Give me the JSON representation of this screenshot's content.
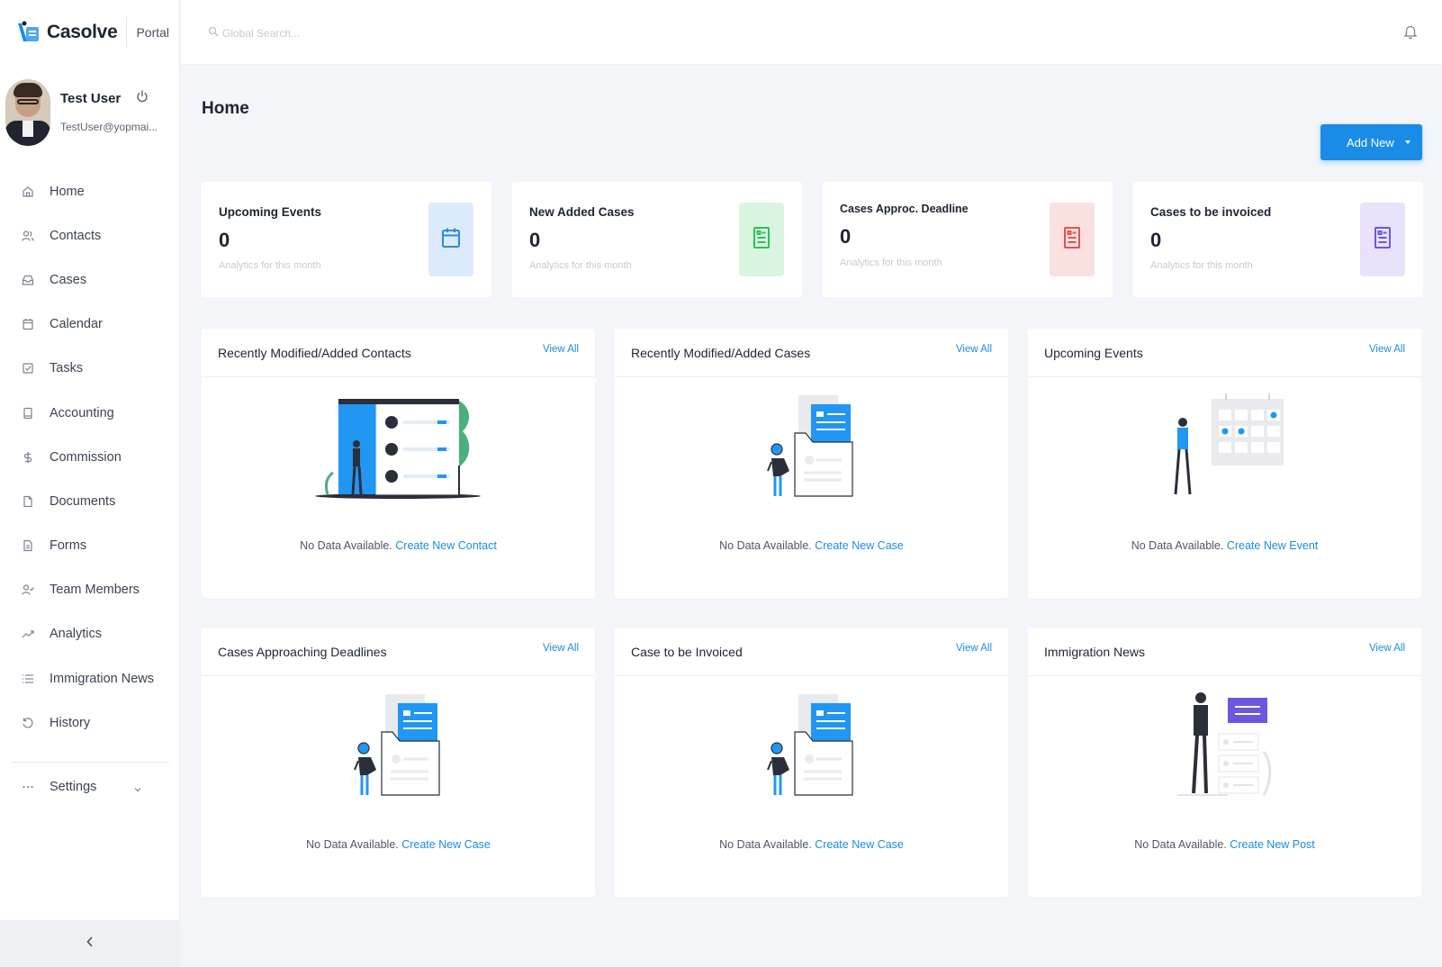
{
  "brand": {
    "name": "Casolve",
    "portal": "Portal"
  },
  "user": {
    "name": "Test User",
    "email": "TestUser@yopmai..."
  },
  "nav": {
    "items": [
      {
        "label": "Home",
        "icon": "home-icon"
      },
      {
        "label": "Contacts",
        "icon": "users-icon"
      },
      {
        "label": "Cases",
        "icon": "inbox-icon"
      },
      {
        "label": "Calendar",
        "icon": "calendar-icon"
      },
      {
        "label": "Tasks",
        "icon": "checkbox-icon"
      },
      {
        "label": "Accounting",
        "icon": "book-icon"
      },
      {
        "label": "Commission",
        "icon": "dollar-icon"
      },
      {
        "label": "Documents",
        "icon": "file-icon"
      },
      {
        "label": "Forms",
        "icon": "form-icon"
      },
      {
        "label": "Team Members",
        "icon": "user-check-icon"
      },
      {
        "label": "Analytics",
        "icon": "trend-icon"
      },
      {
        "label": "Immigration News",
        "icon": "list-icon"
      },
      {
        "label": "History",
        "icon": "history-icon"
      }
    ],
    "settings": {
      "label": "Settings",
      "icon": "dots-icon"
    }
  },
  "search": {
    "placeholder": "Global Search..."
  },
  "page": {
    "title": "Home",
    "add_new_label": "Add New"
  },
  "stats": [
    {
      "title": "Upcoming Events",
      "value": "0",
      "subtitle": "Analytics for this month",
      "icon": "calendar-icon",
      "tile_color": "#dcebfb",
      "icon_color": "#2b8ae6"
    },
    {
      "title": "New Added Cases",
      "value": "0",
      "subtitle": "Analytics for this month",
      "icon": "document-icon",
      "tile_color": "#d9f5df",
      "icon_color": "#2fbf57"
    },
    {
      "title": "Cases Approc. Deadline",
      "value": "0",
      "subtitle": "Analytics for this month",
      "icon": "document-icon",
      "tile_color": "#fbe0e0",
      "icon_color": "#e2524e"
    },
    {
      "title": "Cases to be invoiced",
      "value": "0",
      "subtitle": "Analytics for this month",
      "icon": "document-icon",
      "tile_color": "#e8e2fb",
      "icon_color": "#6e57e0"
    }
  ],
  "panels": [
    {
      "title": "Recently Modified/Added Contacts",
      "view_all": "View All",
      "empty_text": "No Data Available. ",
      "link": "Create New Contact",
      "illustration": "contacts-illustration"
    },
    {
      "title": "Recently Modified/Added Cases",
      "view_all": "View All",
      "empty_text": "No Data Available. ",
      "link": "Create New Case",
      "illustration": "cases-illustration"
    },
    {
      "title": "Upcoming Events",
      "view_all": "View All",
      "empty_text": "No Data Available. ",
      "link": "Create New Event",
      "illustration": "events-illustration"
    },
    {
      "title": "Cases Approaching Deadlines",
      "view_all": "View All",
      "empty_text": "No Data Available. ",
      "link": "Create New Case",
      "illustration": "cases-illustration"
    },
    {
      "title": "Case to be Invoiced",
      "view_all": "View All",
      "empty_text": "No Data Available. ",
      "link": "Create New Case",
      "illustration": "cases-illustration"
    },
    {
      "title": "Immigration News",
      "view_all": "View All",
      "empty_text": "No Data Available. ",
      "link": "Create New Post",
      "illustration": "news-illustration"
    }
  ],
  "colors": {
    "accent": "#1a8ce6",
    "background": "#f3f5f9"
  }
}
